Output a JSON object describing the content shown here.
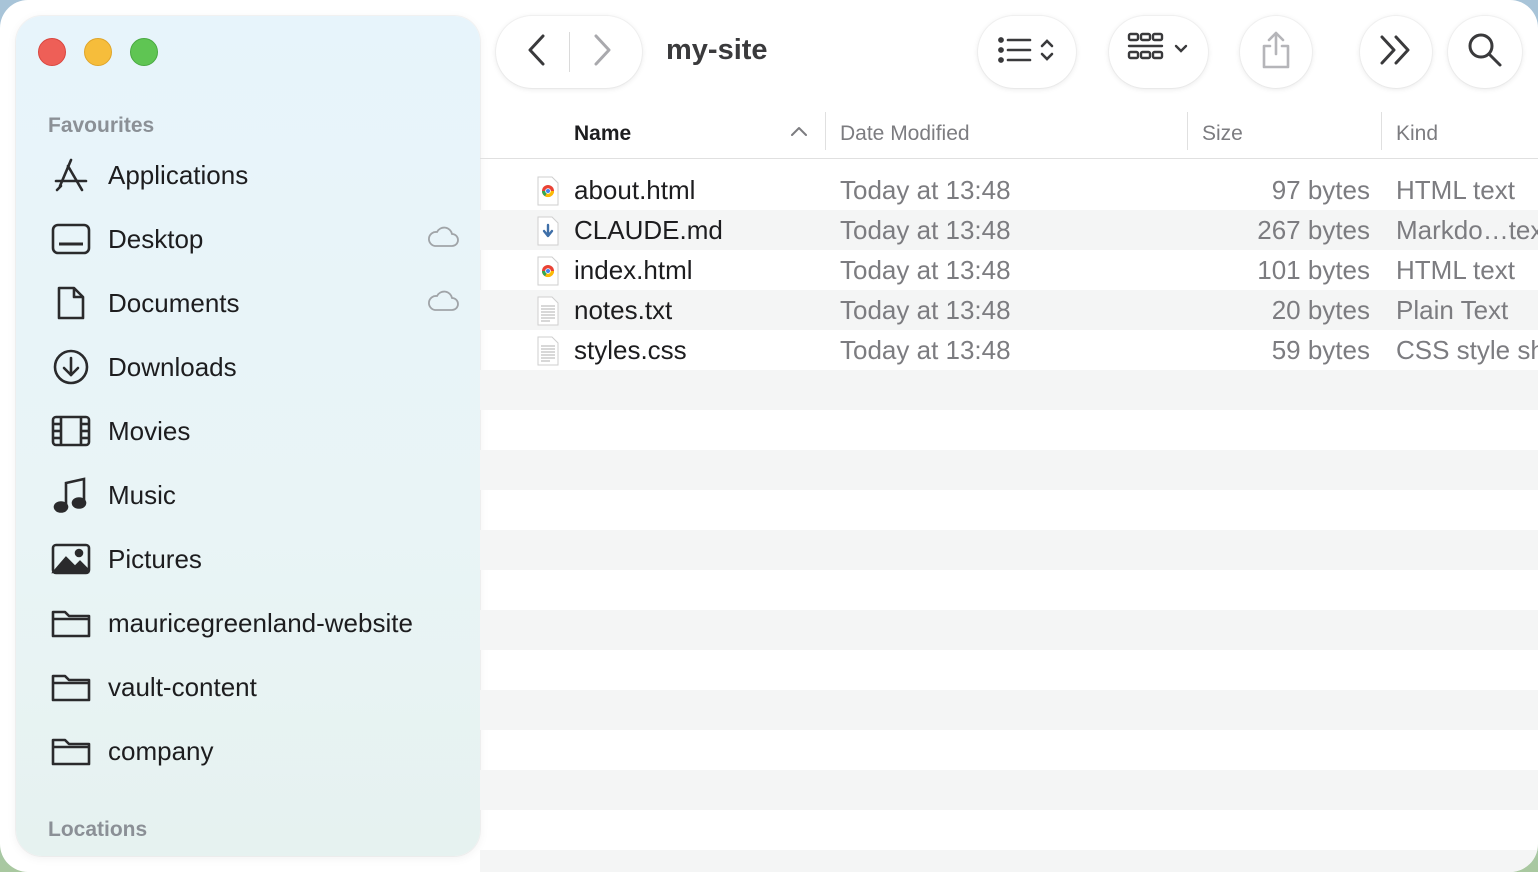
{
  "window": {
    "title": "my-site"
  },
  "sidebar": {
    "favourites_label": "Favourites",
    "locations_label": "Locations",
    "items": [
      {
        "label": "Applications",
        "icon": "applications-icon",
        "cloud": false
      },
      {
        "label": "Desktop",
        "icon": "desktop-icon",
        "cloud": true
      },
      {
        "label": "Documents",
        "icon": "document-icon",
        "cloud": true
      },
      {
        "label": "Downloads",
        "icon": "download-icon",
        "cloud": false
      },
      {
        "label": "Movies",
        "icon": "film-icon",
        "cloud": false
      },
      {
        "label": "Music",
        "icon": "music-note-icon",
        "cloud": false
      },
      {
        "label": "Pictures",
        "icon": "photo-icon",
        "cloud": false
      },
      {
        "label": "mauricegreenland-website",
        "icon": "folder-icon",
        "cloud": false
      },
      {
        "label": "vault-content",
        "icon": "folder-icon",
        "cloud": false
      },
      {
        "label": "company",
        "icon": "folder-icon",
        "cloud": false
      }
    ]
  },
  "columns": {
    "name": "Name",
    "date": "Date Modified",
    "size": "Size",
    "kind": "Kind",
    "sort": "Name ascending"
  },
  "files": [
    {
      "name": "about.html",
      "date": "Today at 13:48",
      "size": "97 bytes",
      "kind": "HTML text",
      "icon": "chrome-html-icon"
    },
    {
      "name": "CLAUDE.md",
      "date": "Today at 13:48",
      "size": "267 bytes",
      "kind": "Markdo…tex",
      "icon": "markdown-icon"
    },
    {
      "name": "index.html",
      "date": "Today at 13:48",
      "size": "101 bytes",
      "kind": "HTML text",
      "icon": "chrome-html-icon"
    },
    {
      "name": "notes.txt",
      "date": "Today at 13:48",
      "size": "20 bytes",
      "kind": "Plain Text",
      "icon": "text-file-icon"
    },
    {
      "name": "styles.css",
      "date": "Today at 13:48",
      "size": "59 bytes",
      "kind": "CSS style sh",
      "icon": "text-file-icon"
    }
  ],
  "colors": {
    "close": "#ee5f57",
    "minimize": "#f6bd3b",
    "maximize": "#5fc553",
    "sidebar_bg": "#e7f4fb",
    "row_alt": "#f4f5f5"
  }
}
